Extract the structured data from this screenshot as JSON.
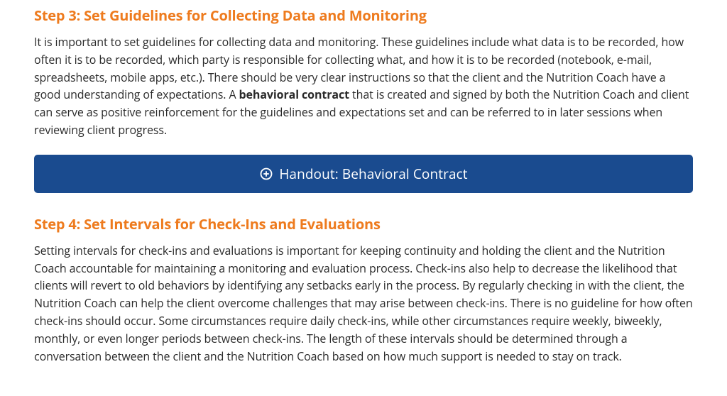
{
  "step3": {
    "heading": "Step 3: Set Guidelines for Collecting Data and Monitoring",
    "text_before_bold": "It is important to set guidelines for collecting data and monitoring. These guidelines include what data is to be recorded, how often it is to be recorded, which party is responsible for collecting what, and how it is to be recorded (notebook, e-mail, spreadsheets, mobile apps, etc.). There should be very clear instructions so that the client and the Nutrition Coach have a good understanding of expectations. A ",
    "bold_phrase": "behavioral contract",
    "text_after_bold": " that is created and signed by both the Nutrition Coach and client can serve as positive reinforcement for the guidelines and expectations set and can be referred to in later sessions when reviewing client progress."
  },
  "handout": {
    "label": "Handout: Behavioral Contract"
  },
  "step4": {
    "heading": "Step 4: Set Intervals for Check-Ins and Evaluations",
    "text": "Setting intervals for check-ins and evaluations is important for keeping continuity and holding the client and the Nutrition Coach accountable for maintaining a monitoring and evaluation process. Check-ins also help to decrease the likelihood that clients will revert to old behaviors by identifying any setbacks early in the process. By regularly checking in with the client, the Nutrition Coach can help the client overcome challenges that may arise between check-ins. There is no guideline for how often check-ins should occur. Some circumstances require daily check-ins, while other circumstances require weekly, biweekly, monthly, or even longer periods between check-ins. The length of these intervals should be determined through a conversation between the client and the Nutrition Coach based on how much support is needed to stay on track."
  }
}
